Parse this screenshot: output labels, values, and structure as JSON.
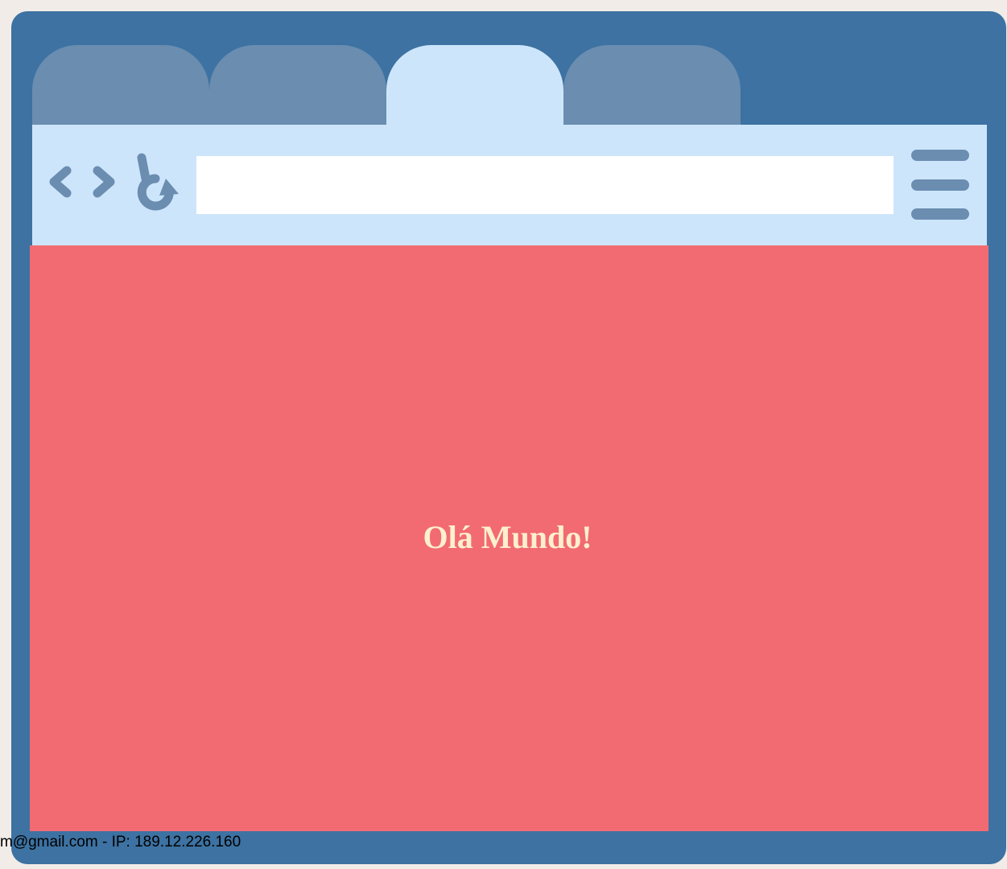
{
  "browser": {
    "tabs": [
      {
        "label": "",
        "active": false
      },
      {
        "label": "",
        "active": false
      },
      {
        "label": "",
        "active": true
      },
      {
        "label": "",
        "active": false
      }
    ],
    "toolbar": {
      "back_icon": "chevron-left-icon",
      "forward_icon": "chevron-right-icon",
      "reload_icon": "reload-icon",
      "menu_icon": "hamburger-menu-icon",
      "address_value": ""
    }
  },
  "page": {
    "heading": "Olá Mundo!"
  },
  "watermark": {
    "text": "m@gmail.com - IP: 189.12.226.160"
  },
  "colors": {
    "frame": "#3d72a2",
    "inactive_tab": "#6a8db0",
    "active_tab": "#cde5fb",
    "content_background": "#f26b72",
    "heading_text": "#fdf0cc"
  }
}
